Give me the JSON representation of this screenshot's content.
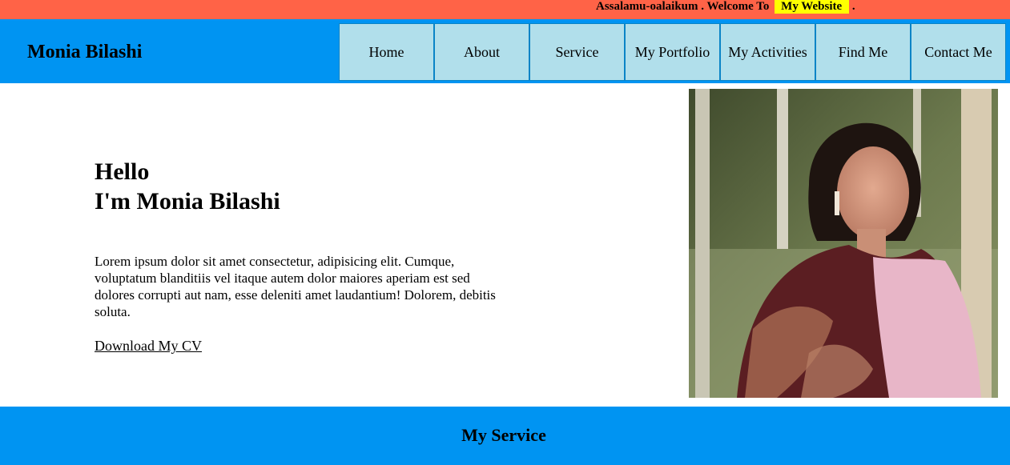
{
  "topbar": {
    "greeting": "Assalamu-oalaikum . Welcome To",
    "highlight": "My Website",
    "trailing": ".",
    "bg_color": "#ff6347",
    "highlight_color": "#ffff00"
  },
  "navbar": {
    "brand": "Monia Bilashi",
    "bg_color": "#0094f2",
    "items": [
      {
        "label": "Home"
      },
      {
        "label": "About"
      },
      {
        "label": "Service"
      },
      {
        "label": "My Portfolio"
      },
      {
        "label": "My Activities"
      },
      {
        "label": "Find Me"
      },
      {
        "label": "Contact Me"
      }
    ]
  },
  "hero": {
    "line1": "Hello",
    "line2": "I'm Monia Bilashi",
    "paragraph": "Lorem ipsum dolor sit amet consectetur, adipisicing elit. Cumque, voluptatum blanditiis vel itaque autem dolor maiores aperiam est sed dolores corrupti aut nam, esse deleniti amet laudantium! Dolorem, debitis soluta.",
    "cv_link": "Download My CV"
  },
  "service": {
    "title": "My Service"
  }
}
